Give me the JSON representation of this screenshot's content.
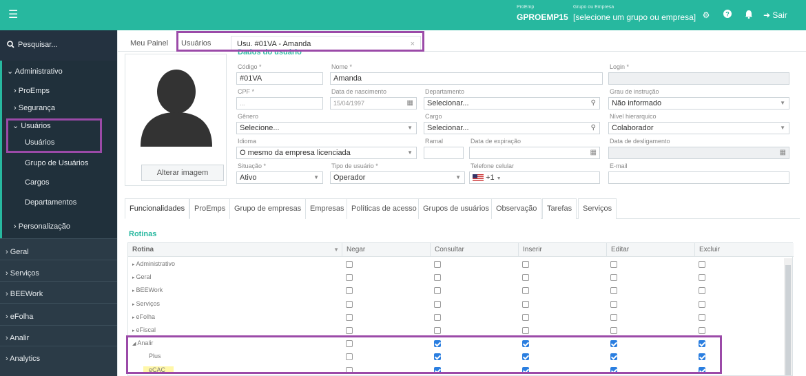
{
  "topbar": {
    "proemp_label": "ProEmp",
    "proemp_value": "GPROEMP15",
    "group_label": "Grupo ou Empresa",
    "group_value": "[selecione um grupo ou empresa]",
    "logout_label": "Sair"
  },
  "sidebar": {
    "search_label": "Pesquisar...",
    "items": [
      {
        "label": "Administrativo"
      },
      {
        "label": "ProEmps"
      },
      {
        "label": "Segurança"
      },
      {
        "label": "Usuários"
      },
      {
        "label": "Usuários"
      },
      {
        "label": "Grupo de Usuários"
      },
      {
        "label": "Cargos"
      },
      {
        "label": "Departamentos"
      },
      {
        "label": "Personalização"
      },
      {
        "label": "Geral"
      },
      {
        "label": "Serviços"
      },
      {
        "label": "BEEWork"
      },
      {
        "label": "eFolha"
      },
      {
        "label": "Analir"
      },
      {
        "label": "Analytics"
      }
    ]
  },
  "tabs": {
    "panel": "Meu Painel",
    "users": "Usuários",
    "current": "Usu. #01VA - Amanda"
  },
  "section_title": "Dados do usuário",
  "avatar": {
    "button_label": "Alterar imagem"
  },
  "form": {
    "codigo": {
      "label": "Código *",
      "value": "#01VA"
    },
    "nome": {
      "label": "Nome *",
      "value": "Amanda"
    },
    "login": {
      "label": "Login *",
      "value": ""
    },
    "cpf": {
      "label": "CPF *",
      "value": "..."
    },
    "nascimento": {
      "label": "Data de nascimento",
      "value": "15/04/1997"
    },
    "departamento": {
      "label": "Departamento",
      "value": "Selecionar..."
    },
    "instrucao": {
      "label": "Grau de instrução",
      "value": "Não informado"
    },
    "genero": {
      "label": "Gênero",
      "value": "Selecione..."
    },
    "cargo": {
      "label": "Cargo",
      "value": "Selecionar..."
    },
    "nivel": {
      "label": "Nível hierarquico",
      "value": "Colaborador"
    },
    "idioma": {
      "label": "Idioma",
      "value": "O mesmo da empresa licenciada"
    },
    "ramal": {
      "label": "Ramal",
      "value": ""
    },
    "expiracao": {
      "label": "Data de expiração",
      "value": ""
    },
    "desligamento": {
      "label": "Data de desligamento",
      "value": ""
    },
    "situacao": {
      "label": "Situação *",
      "value": "Ativo"
    },
    "tipo": {
      "label": "Tipo de usuário *",
      "value": "Operador"
    },
    "telefone": {
      "label": "Telefone celular",
      "value": "+1"
    },
    "email": {
      "label": "E-mail",
      "value": ""
    }
  },
  "subtabs": [
    "Funcionalidades",
    "ProEmps",
    "Grupo de empresas",
    "Empresas",
    "Políticas de acesso",
    "Grupos de usuários",
    "Observação",
    "Tarefas",
    "Serviços"
  ],
  "grid": {
    "title": "Rotinas",
    "headers": [
      "Rotina",
      "Negar",
      "Consultar",
      "Inserir",
      "Editar",
      "Excluir"
    ],
    "rows": [
      {
        "label": "Administrativo",
        "checks": [
          false,
          false,
          false,
          false,
          false
        ]
      },
      {
        "label": "Geral",
        "checks": [
          false,
          false,
          false,
          false,
          false
        ]
      },
      {
        "label": "BEEWork",
        "checks": [
          false,
          false,
          false,
          false,
          false
        ]
      },
      {
        "label": "Serviços",
        "checks": [
          false,
          false,
          false,
          false,
          false
        ]
      },
      {
        "label": "eFolha",
        "checks": [
          false,
          false,
          false,
          false,
          false
        ]
      },
      {
        "label": "eFiscal",
        "checks": [
          false,
          false,
          false,
          false,
          false
        ]
      },
      {
        "label": "Analir",
        "checks": [
          false,
          true,
          true,
          true,
          true
        ]
      },
      {
        "label": "Plus",
        "checks": [
          false,
          true,
          true,
          true,
          true
        ]
      },
      {
        "label": "eCAC",
        "checks": [
          false,
          true,
          true,
          true,
          true
        ]
      }
    ]
  },
  "colors": {
    "accent": "#27b89f",
    "sidebar": "#2b3b47",
    "highlight": "#9b4aa8",
    "checkbox": "#2a7ee0"
  }
}
